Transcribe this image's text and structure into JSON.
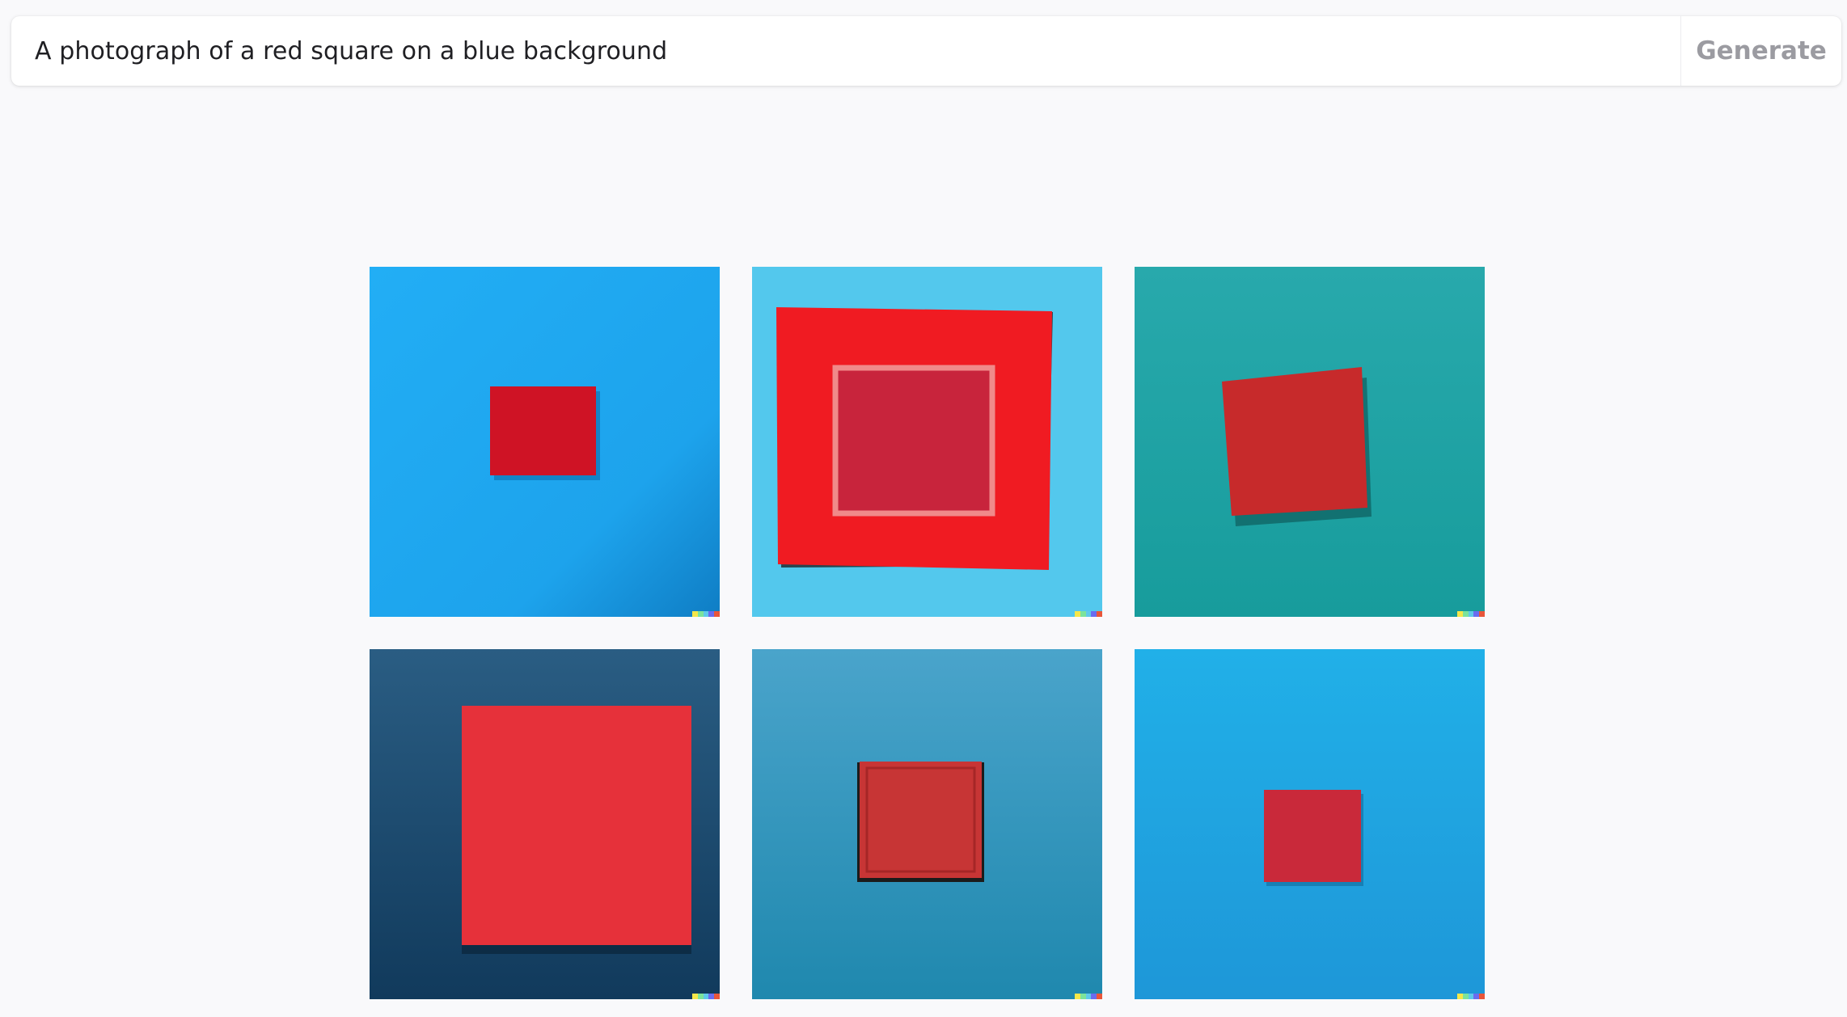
{
  "prompt": {
    "value": "A photograph of a red square on a blue background",
    "generate_label": "Generate"
  },
  "images": [
    {
      "background": "#1fa5ef",
      "square": "#cf1325"
    },
    {
      "background": "#52c9ec",
      "square": "#f01b22"
    },
    {
      "background": "#1fa4a8",
      "square": "#c72a2b"
    },
    {
      "background": "#1e4f76",
      "square": "#e6313a"
    },
    {
      "background": "#3195bb",
      "square": "#c73535"
    },
    {
      "background": "#1eaae4",
      "square": "#c9293a"
    }
  ],
  "signature_colors": [
    "#f5e74a",
    "#7ce39b",
    "#5fc9ea",
    "#6a6cef",
    "#e9563a"
  ]
}
